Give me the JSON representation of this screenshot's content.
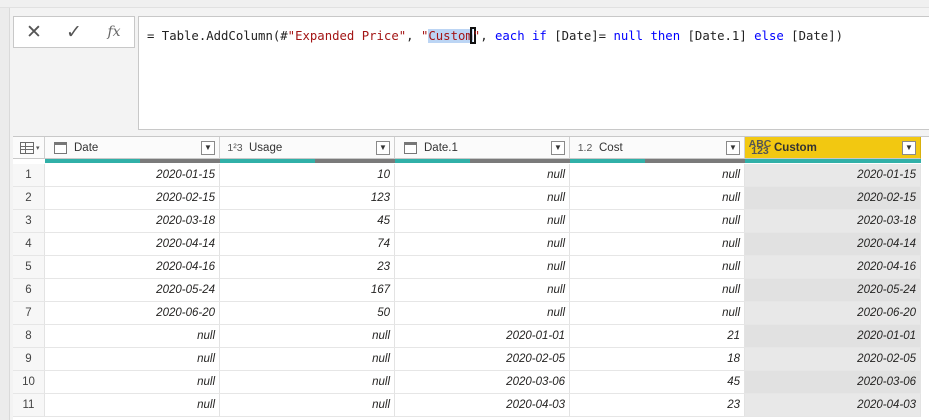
{
  "formula_bar": {
    "cancel_icon": "close-icon",
    "commit_icon": "check-icon",
    "fx_label": "fx",
    "formula_parts": {
      "p1": "= Table.AddColumn(#",
      "p2": "\"Expanded Price\"",
      "p3": ", ",
      "p4": "\"",
      "p5": "Custom",
      "p6": "\"",
      "p7": ", ",
      "p8": "each if",
      "p9": " [Date]= ",
      "p10": "null then",
      "p11": " [Date.1] ",
      "p12": "else",
      "p13": " [Date])"
    }
  },
  "grid": {
    "columns": [
      {
        "label": "Date",
        "type_icon": "calendar-icon"
      },
      {
        "label": "Usage",
        "type_icon": "whole-number-icon",
        "type_text": "1²3"
      },
      {
        "label": "Date.1",
        "type_icon": "calendar-icon"
      },
      {
        "label": "Cost",
        "type_icon": "decimal-icon",
        "type_text": "1.2"
      },
      {
        "label": "Custom",
        "type_icon": "any-type-icon",
        "type_text": "ABC 123"
      }
    ],
    "rows": [
      {
        "n": "1",
        "date": "2020-01-15",
        "usage": "10",
        "date1": "null",
        "cost": "null",
        "custom": "2020-01-15"
      },
      {
        "n": "2",
        "date": "2020-02-15",
        "usage": "123",
        "date1": "null",
        "cost": "null",
        "custom": "2020-02-15"
      },
      {
        "n": "3",
        "date": "2020-03-18",
        "usage": "45",
        "date1": "null",
        "cost": "null",
        "custom": "2020-03-18"
      },
      {
        "n": "4",
        "date": "2020-04-14",
        "usage": "74",
        "date1": "null",
        "cost": "null",
        "custom": "2020-04-14"
      },
      {
        "n": "5",
        "date": "2020-04-16",
        "usage": "23",
        "date1": "null",
        "cost": "null",
        "custom": "2020-04-16"
      },
      {
        "n": "6",
        "date": "2020-05-24",
        "usage": "167",
        "date1": "null",
        "cost": "null",
        "custom": "2020-05-24"
      },
      {
        "n": "7",
        "date": "2020-06-20",
        "usage": "50",
        "date1": "null",
        "cost": "null",
        "custom": "2020-06-20"
      },
      {
        "n": "8",
        "date": "null",
        "usage": "null",
        "date1": "2020-01-01",
        "cost": "21",
        "custom": "2020-01-01"
      },
      {
        "n": "9",
        "date": "null",
        "usage": "null",
        "date1": "2020-02-05",
        "cost": "18",
        "custom": "2020-02-05"
      },
      {
        "n": "10",
        "date": "null",
        "usage": "null",
        "date1": "2020-03-06",
        "cost": "45",
        "custom": "2020-03-06"
      },
      {
        "n": "11",
        "date": "null",
        "usage": "null",
        "date1": "2020-04-03",
        "cost": "23",
        "custom": "2020-04-03"
      }
    ]
  },
  "colors": {
    "selected_header": "#f2c811",
    "quality_valid": "#31b0a8",
    "keyword": "#0000ff",
    "string": "#a31515"
  }
}
